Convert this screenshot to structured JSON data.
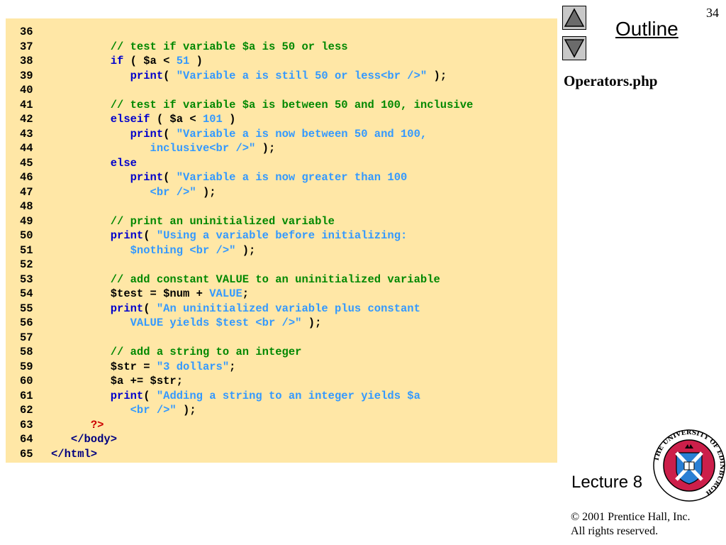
{
  "slide": {
    "page_number": "34",
    "outline_label": "Outline",
    "file_name": "Operators.php",
    "lecture_label": "Lecture 8",
    "copyright_line1": "© 2001 Prentice Hall, Inc.",
    "copyright_line2": "All rights reserved.",
    "crest_text": "THE UNIVERSITY OF EDINBURGH"
  },
  "colors": {
    "code_background": "#ffe7a6",
    "keyword": "#0000cc",
    "comment": "#008800",
    "string": "#3399ff",
    "php_tag": "#cc0000",
    "html_tag": "#000080"
  },
  "code": [
    {
      "num": "36",
      "tokens": []
    },
    {
      "num": "37",
      "tokens": [
        {
          "t": "ind",
          "v": "         "
        },
        {
          "t": "cmt",
          "v": "// test if variable $a is 50 or less"
        }
      ]
    },
    {
      "num": "38",
      "tokens": [
        {
          "t": "ind",
          "v": "         "
        },
        {
          "t": "kw",
          "v": "if"
        },
        {
          "t": "plain",
          "v": " ( $a < "
        },
        {
          "t": "num",
          "v": "51"
        },
        {
          "t": "plain",
          "v": " )"
        }
      ]
    },
    {
      "num": "39",
      "tokens": [
        {
          "t": "ind",
          "v": "            "
        },
        {
          "t": "kw",
          "v": "print"
        },
        {
          "t": "plain",
          "v": "( "
        },
        {
          "t": "str",
          "v": "\"Variable a is still 50 or less<br />\""
        },
        {
          "t": "plain",
          "v": " );"
        }
      ]
    },
    {
      "num": "40",
      "tokens": []
    },
    {
      "num": "41",
      "tokens": [
        {
          "t": "ind",
          "v": "         "
        },
        {
          "t": "cmt",
          "v": "// test if variable $a is between 50 and 100, inclusive"
        }
      ]
    },
    {
      "num": "42",
      "tokens": [
        {
          "t": "ind",
          "v": "         "
        },
        {
          "t": "kw",
          "v": "elseif"
        },
        {
          "t": "plain",
          "v": " ( $a < "
        },
        {
          "t": "num",
          "v": "101"
        },
        {
          "t": "plain",
          "v": " )"
        }
      ]
    },
    {
      "num": "43",
      "tokens": [
        {
          "t": "ind",
          "v": "            "
        },
        {
          "t": "kw",
          "v": "print"
        },
        {
          "t": "plain",
          "v": "( "
        },
        {
          "t": "str",
          "v": "\"Variable a is now between 50 and 100,"
        }
      ]
    },
    {
      "num": "44",
      "tokens": [
        {
          "t": "ind",
          "v": "               "
        },
        {
          "t": "str",
          "v": "inclusive<br />\""
        },
        {
          "t": "plain",
          "v": " );"
        }
      ]
    },
    {
      "num": "45",
      "tokens": [
        {
          "t": "ind",
          "v": "         "
        },
        {
          "t": "kw",
          "v": "else"
        }
      ]
    },
    {
      "num": "46",
      "tokens": [
        {
          "t": "ind",
          "v": "            "
        },
        {
          "t": "kw",
          "v": "print"
        },
        {
          "t": "plain",
          "v": "( "
        },
        {
          "t": "str",
          "v": "\"Variable a is now greater than 100"
        }
      ]
    },
    {
      "num": "47",
      "tokens": [
        {
          "t": "ind",
          "v": "               "
        },
        {
          "t": "str",
          "v": "<br />\""
        },
        {
          "t": "plain",
          "v": " );"
        }
      ]
    },
    {
      "num": "48",
      "tokens": []
    },
    {
      "num": "49",
      "tokens": [
        {
          "t": "ind",
          "v": "         "
        },
        {
          "t": "cmt",
          "v": "// print an uninitialized variable"
        }
      ]
    },
    {
      "num": "50",
      "tokens": [
        {
          "t": "ind",
          "v": "         "
        },
        {
          "t": "kw",
          "v": "print"
        },
        {
          "t": "plain",
          "v": "( "
        },
        {
          "t": "str",
          "v": "\"Using a variable before initializing:"
        }
      ]
    },
    {
      "num": "51",
      "tokens": [
        {
          "t": "ind",
          "v": "            "
        },
        {
          "t": "str",
          "v": "$nothing <br />\""
        },
        {
          "t": "plain",
          "v": " );"
        }
      ]
    },
    {
      "num": "52",
      "tokens": []
    },
    {
      "num": "53",
      "tokens": [
        {
          "t": "ind",
          "v": "         "
        },
        {
          "t": "cmt",
          "v": "// add constant VALUE to an uninitialized variable"
        }
      ]
    },
    {
      "num": "54",
      "tokens": [
        {
          "t": "ind",
          "v": "         "
        },
        {
          "t": "plain",
          "v": "$test = $num + "
        },
        {
          "t": "const",
          "v": "VALUE"
        },
        {
          "t": "plain",
          "v": ";"
        }
      ]
    },
    {
      "num": "55",
      "tokens": [
        {
          "t": "ind",
          "v": "         "
        },
        {
          "t": "kw",
          "v": "print"
        },
        {
          "t": "plain",
          "v": "( "
        },
        {
          "t": "str",
          "v": "\"An uninitialized variable plus constant"
        }
      ]
    },
    {
      "num": "56",
      "tokens": [
        {
          "t": "ind",
          "v": "            "
        },
        {
          "t": "str",
          "v": "VALUE yields $test <br />\""
        },
        {
          "t": "plain",
          "v": " );"
        }
      ]
    },
    {
      "num": "57",
      "tokens": []
    },
    {
      "num": "58",
      "tokens": [
        {
          "t": "ind",
          "v": "         "
        },
        {
          "t": "cmt",
          "v": "// add a string to an integer"
        }
      ]
    },
    {
      "num": "59",
      "tokens": [
        {
          "t": "ind",
          "v": "         "
        },
        {
          "t": "plain",
          "v": "$str = "
        },
        {
          "t": "str",
          "v": "\"3 dollars\""
        },
        {
          "t": "plain",
          "v": ";"
        }
      ]
    },
    {
      "num": "60",
      "tokens": [
        {
          "t": "ind",
          "v": "         "
        },
        {
          "t": "plain",
          "v": "$a += $str;"
        }
      ]
    },
    {
      "num": "61",
      "tokens": [
        {
          "t": "ind",
          "v": "         "
        },
        {
          "t": "kw",
          "v": "print"
        },
        {
          "t": "plain",
          "v": "( "
        },
        {
          "t": "str",
          "v": "\"Adding a string to an integer yields $a"
        }
      ]
    },
    {
      "num": "62",
      "tokens": [
        {
          "t": "ind",
          "v": "            "
        },
        {
          "t": "str",
          "v": "<br />\""
        },
        {
          "t": "plain",
          "v": " );"
        }
      ]
    },
    {
      "num": "63",
      "tokens": [
        {
          "t": "ind",
          "v": "      "
        },
        {
          "t": "tag",
          "v": "?>"
        }
      ]
    },
    {
      "num": "64",
      "tokens": [
        {
          "t": "ind",
          "v": "   "
        },
        {
          "t": "html",
          "v": "</body>"
        }
      ]
    },
    {
      "num": "65",
      "tokens": [
        {
          "t": "html",
          "v": "</html>"
        }
      ]
    }
  ]
}
